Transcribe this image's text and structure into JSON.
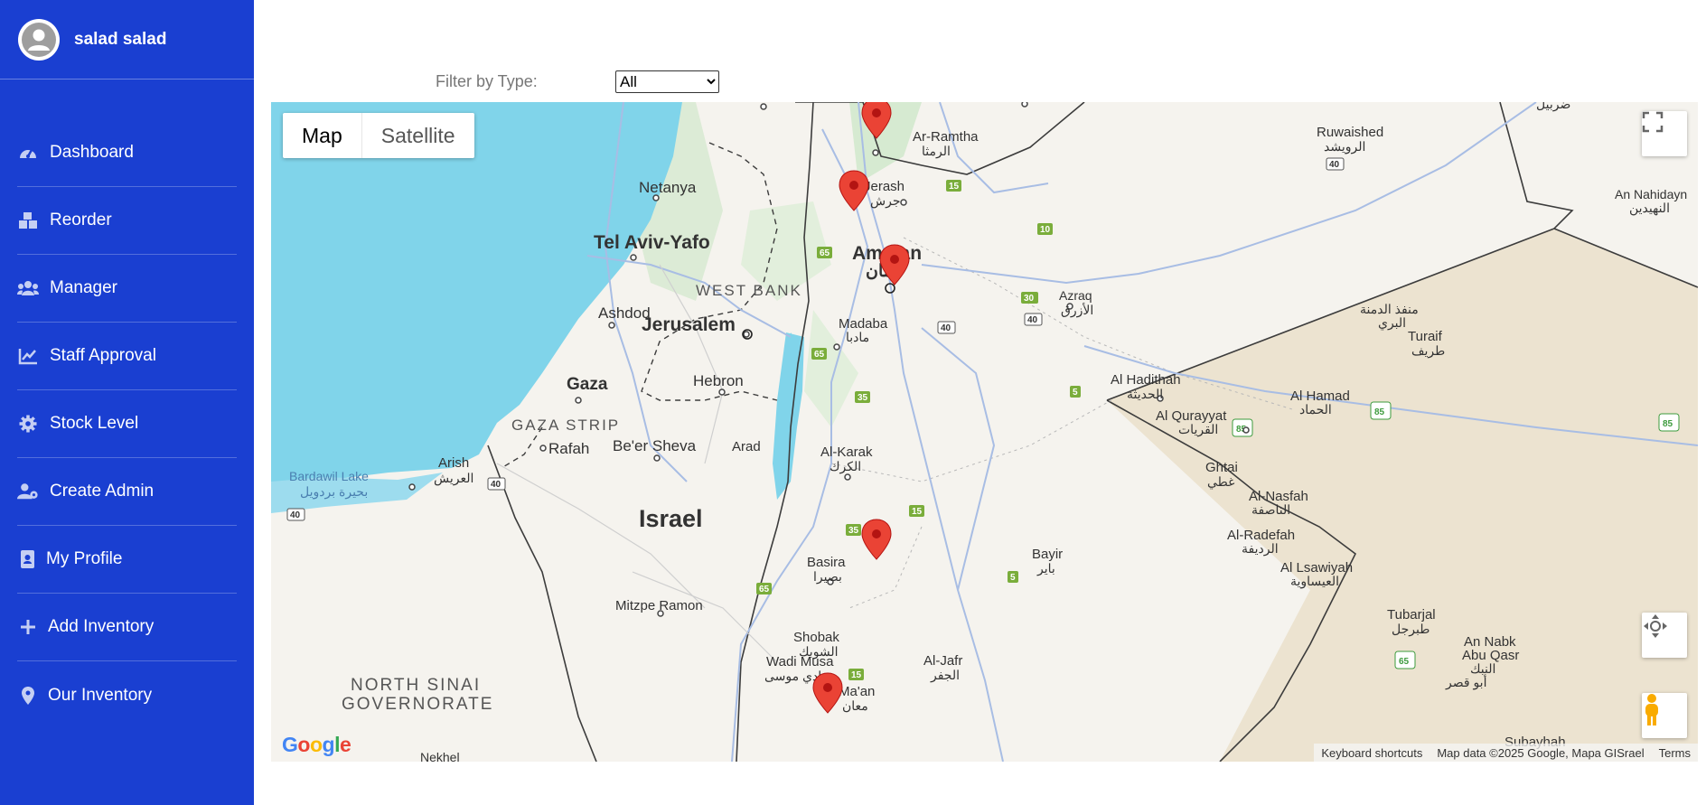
{
  "user": {
    "name": "salad salad"
  },
  "nav": [
    {
      "label": "Dashboard",
      "icon": "gauge-icon"
    },
    {
      "label": "Reorder",
      "icon": "boxes-icon"
    },
    {
      "label": "Manager",
      "icon": "users-icon"
    },
    {
      "label": "Staff Approval",
      "icon": "chart-line-icon"
    },
    {
      "label": "Stock Level",
      "icon": "gear-icon"
    },
    {
      "label": "Create Admin",
      "icon": "user-cog-icon"
    },
    {
      "label": "My Profile",
      "icon": "id-badge-icon"
    },
    {
      "label": "Add Inventory",
      "icon": "plus-icon"
    },
    {
      "label": "Our Inventory",
      "icon": "map-marker-icon"
    }
  ],
  "filter": {
    "label": "Filter by Type:",
    "selected": "All",
    "options": [
      "All"
    ]
  },
  "map": {
    "type_buttons": {
      "map": "Map",
      "satellite": "Satellite"
    },
    "active_type": "Map",
    "logo": "Google",
    "footer": {
      "shortcuts": "Keyboard shortcuts",
      "attribution": "Map data ©2025 Google, Mapa GISrael",
      "terms": "Terms"
    },
    "places": {
      "netanya": "Netanya",
      "telaviv": "Tel Aviv-Yafo",
      "ashdod": "Ashdod",
      "jerusalem": "Jerusalem",
      "westbank": "WEST BANK",
      "gaza": "Gaza",
      "hebron": "Hebron",
      "gazastrip": "GAZA STRIP",
      "rafah": "Rafah",
      "beersheva": "Be'er Sheva",
      "arad": "Arad",
      "arish": "Arish",
      "arish_ar": "العريش",
      "bardawil": "Bardawil Lake",
      "bardawil_ar": "بحيرة بردويل",
      "israel": "Israel",
      "mitzpe": "Mitzpe Ramon",
      "northsinai1": "NORTH SINAI",
      "northsinai2": "GOVERNORATE",
      "nekhel": "Nekhel",
      "amman": "Amman",
      "amman_ar": "عمان",
      "jerash": "Jerash",
      "jerash_ar": "جرش",
      "ramtha": "Ar-Ramtha",
      "ramtha_ar": "الرمثا",
      "madaba": "Madaba",
      "madaba_ar": "مادبا",
      "karak": "Al-Karak",
      "karak_ar": "الكرك",
      "basira": "Basira",
      "basira_ar": "بصيرا",
      "shobak": "Shobak",
      "shobak_ar": "الشوبك",
      "wadimusa": "Wadi Musa",
      "wadimusa_ar": "وادي موسى",
      "maan": "Ma'an",
      "maan_ar": "معان",
      "jafr": "Al-Jafr",
      "jafr_ar": "الجفر",
      "bayir": "Bayir",
      "bayir_ar": "باير",
      "azraq": "Azraq",
      "azraq_ar": "الأزرق",
      "haditha": "Al Hadithah",
      "haditha_ar": "الحديثة",
      "qurayyat": "Al Qurayyat",
      "qurayyat_ar": "القريات",
      "ghtai": "Ghtai",
      "ghtai_ar": "غطي",
      "nasfah": "Al-Nasfah",
      "nasfah_ar": "الناصفة",
      "radefah": "Al-Radefah",
      "radefah_ar": "الرديفة",
      "lsawiyah": "Al Lsawiyah",
      "lsawiyah_ar": "العيساوية",
      "hamad": "Al Hamad",
      "hamad_ar": "الحماد",
      "turaif": "Turaif",
      "turaif_ar": "طريف",
      "munfadh": "منفذ الدمنة",
      "munfadh2": "البري",
      "ruwaished": "Ruwaished",
      "ruwaished_ar": "الرويشد",
      "nahidayn": "An Nahidayn",
      "nahidayn_ar": "النهيدين",
      "tubarjal": "Tubarjal",
      "tubarjal_ar": "طبرجل",
      "nabk": "An Nabk",
      "abuqasr": "Abu Qasr",
      "nabk_ar": "النبك",
      "abuqasr_ar": "أبو قصر",
      "subayhah": "Subayhah",
      "top_ar": "ضربيل"
    },
    "road_shields": [
      "15",
      "10",
      "40",
      "65",
      "30",
      "40",
      "40",
      "65",
      "35",
      "5",
      "15",
      "35",
      "5",
      "65",
      "15",
      "85",
      "85",
      "85",
      "65",
      "40",
      "40"
    ],
    "marker_color": "#ea4335",
    "colors": {
      "water": "#80d4ea",
      "land": "#f5f3ee",
      "desert": "#ece3d0",
      "green": "#d6ead1",
      "road": "#a8bde4",
      "border": "#3c3c3c"
    },
    "marker_count": 5
  }
}
